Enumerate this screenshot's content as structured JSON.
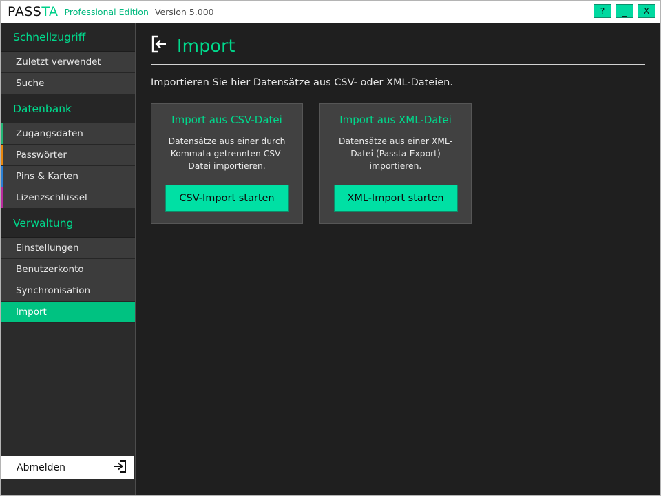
{
  "window": {
    "brand_first": "PASS",
    "brand_accent": "TA",
    "edition": "Professional Edition",
    "version": "Version 5.000",
    "buttons": {
      "help": "?",
      "minimize": "_",
      "close": "X"
    }
  },
  "sidebar": {
    "sections": [
      {
        "header": "Schnellzugriff",
        "items": [
          {
            "label": "Zuletzt verwendet",
            "accent": "",
            "active": false
          },
          {
            "label": "Suche",
            "accent": "",
            "active": false
          }
        ]
      },
      {
        "header": "Datenbank",
        "items": [
          {
            "label": "Zugangsdaten",
            "accent": "#21b573",
            "active": false
          },
          {
            "label": "Passwörter",
            "accent": "#e8860c",
            "active": false
          },
          {
            "label": "Pins & Karten",
            "accent": "#2a7fd4",
            "active": false
          },
          {
            "label": "Lizenzschlüssel",
            "accent": "#bb2a9e",
            "active": false
          }
        ]
      },
      {
        "header": "Verwaltung",
        "items": [
          {
            "label": "Einstellungen",
            "accent": "",
            "active": false
          },
          {
            "label": "Benutzerkonto",
            "accent": "",
            "active": false
          },
          {
            "label": "Synchronisation",
            "accent": "",
            "active": false
          },
          {
            "label": "Import",
            "accent": "",
            "active": true
          }
        ]
      }
    ],
    "logout": {
      "label": "Abmelden",
      "icon": "logout-icon"
    }
  },
  "main": {
    "icon": "import-icon",
    "title": "Import",
    "intro": "Importieren Sie hier Datensätze aus CSV- oder XML-Dateien.",
    "cards": [
      {
        "title": "Import aus CSV-Datei",
        "description": "Datensätze aus einer durch Kommata getrennten CSV-Datei importieren.",
        "button": "CSV-Import starten"
      },
      {
        "title": "Import aus XML-Datei",
        "description": "Datensätze aus einer XML-Datei (Passta-Export) importieren.",
        "button": "XML-Import starten"
      }
    ]
  },
  "colors": {
    "accent_green": "#00d98c",
    "button_green": "#00e0a4",
    "active_green": "#00c281",
    "sidebar_bg": "#2b2b2b",
    "item_bg": "#3c3c3c",
    "main_bg": "#1f1f1f",
    "card_bg": "#414141"
  }
}
